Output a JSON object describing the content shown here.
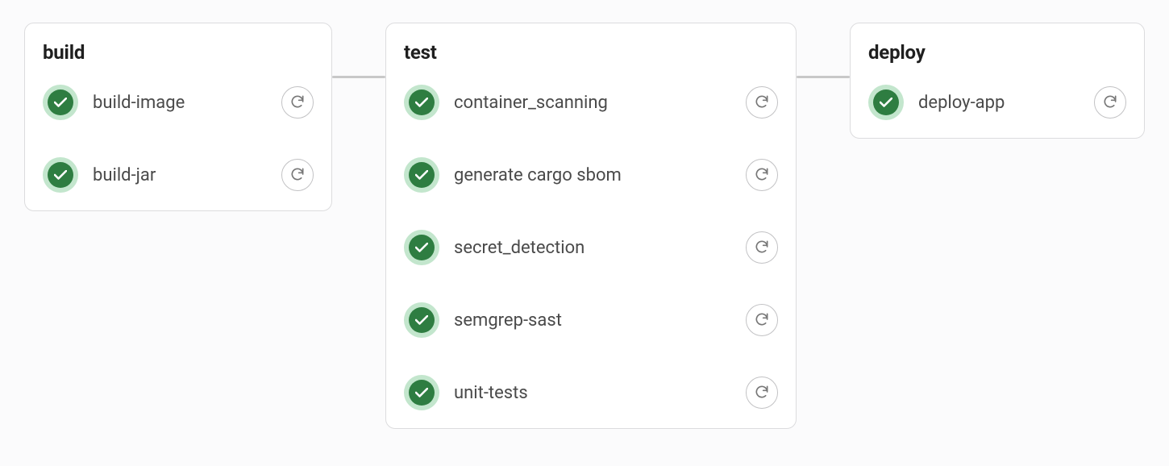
{
  "colors": {
    "success_bg": "#c3e6cd",
    "success_fg": "#2e7d41",
    "card_border": "#dcdcde"
  },
  "pipeline": {
    "stages": [
      {
        "id": "build",
        "title": "build",
        "jobs": [
          {
            "name": "build-image",
            "status": "success"
          },
          {
            "name": "build-jar",
            "status": "success"
          }
        ]
      },
      {
        "id": "test",
        "title": "test",
        "jobs": [
          {
            "name": "container_scanning",
            "status": "success"
          },
          {
            "name": "generate cargo sbom",
            "status": "success"
          },
          {
            "name": "secret_detection",
            "status": "success"
          },
          {
            "name": "semgrep-sast",
            "status": "success"
          },
          {
            "name": "unit-tests",
            "status": "success"
          }
        ]
      },
      {
        "id": "deploy",
        "title": "deploy",
        "jobs": [
          {
            "name": "deploy-app",
            "status": "success"
          }
        ]
      }
    ]
  }
}
